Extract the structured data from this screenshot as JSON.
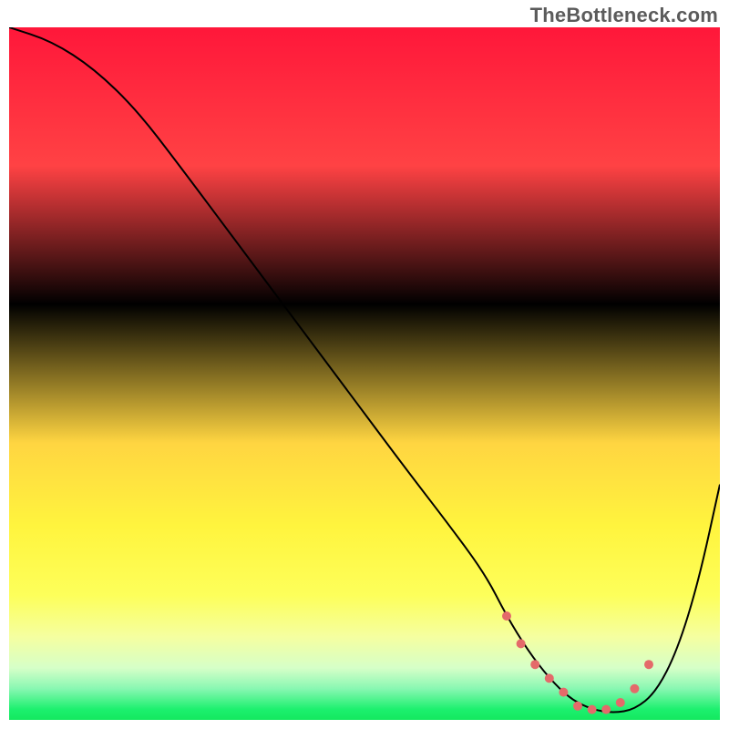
{
  "watermark": {
    "text": "TheBottleneck.com"
  },
  "chart_data": {
    "type": "line",
    "title": "",
    "xlabel": "",
    "ylabel": "",
    "xlim": [
      0,
      100
    ],
    "ylim": [
      0,
      100
    ],
    "grid": false,
    "legend": false,
    "background": {
      "kind": "vertical-gradient",
      "stops": [
        {
          "pos": 0.0,
          "color": "#ff173a"
        },
        {
          "pos": 0.2,
          "color": "#ff4244"
        },
        {
          "pos": 0.4,
          "color": "#ff845"
        },
        {
          "pos": 0.6,
          "color": "#ffd541"
        },
        {
          "pos": 0.72,
          "color": "#fff43e"
        },
        {
          "pos": 0.82,
          "color": "#fdff5a"
        },
        {
          "pos": 0.88,
          "color": "#f5ffa0"
        },
        {
          "pos": 0.925,
          "color": "#d6ffc8"
        },
        {
          "pos": 0.955,
          "color": "#88f7b2"
        },
        {
          "pos": 0.985,
          "color": "#1cf06e"
        },
        {
          "pos": 1.0,
          "color": "#14e85f"
        }
      ]
    },
    "series": [
      {
        "name": "bottleneck-curve",
        "color": "#000000",
        "stroke_width": 2,
        "x": [
          0,
          6,
          12,
          18,
          24,
          32,
          40,
          48,
          56,
          62,
          67,
          70,
          73,
          76,
          79,
          82,
          85,
          88,
          91,
          94,
          97,
          100
        ],
        "y": [
          100,
          98,
          94,
          88,
          80,
          69,
          58,
          47,
          36,
          28,
          21,
          15,
          10,
          6,
          3,
          1.5,
          1,
          1.5,
          4,
          10,
          20,
          34
        ]
      }
    ],
    "highlight": {
      "name": "low-bottleneck-band",
      "color": "#e46a6a",
      "marker": "dot",
      "marker_size": 5,
      "x": [
        70,
        72,
        74,
        76,
        78,
        80,
        82,
        84,
        86,
        88,
        90
      ],
      "y": [
        15,
        11,
        8,
        6,
        4,
        2,
        1.5,
        1.5,
        2.5,
        4.5,
        8
      ]
    }
  }
}
